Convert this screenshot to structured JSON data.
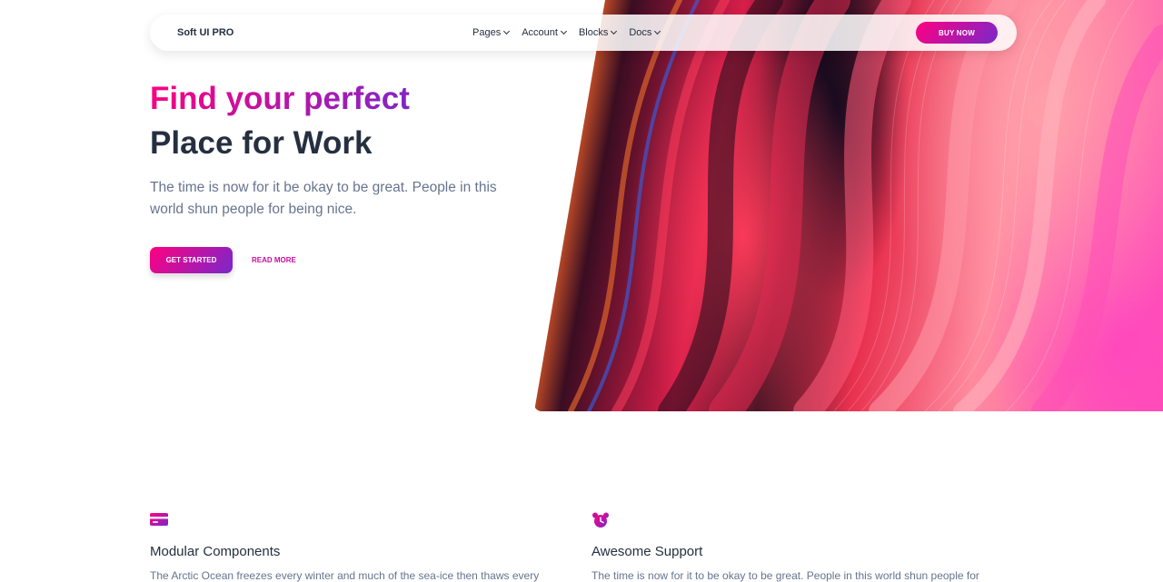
{
  "navbar": {
    "brand": "Soft UI PRO",
    "menu": [
      {
        "label": "Pages"
      },
      {
        "label": "Account"
      },
      {
        "label": "Blocks"
      },
      {
        "label": "Docs"
      }
    ],
    "cta_label": "BUY NOW"
  },
  "hero": {
    "title_line1": "Find your perfect",
    "title_line2": "Place for Work",
    "description": "The time is now for it be okay to be great. People in this world shun people for being nice.",
    "primary_button": "GET STARTED",
    "secondary_link": "READ MORE"
  },
  "features": [
    {
      "icon": "credit-card-icon",
      "title": "Modular Components",
      "text": "The Arctic Ocean freezes every winter and much of the sea-ice then thaws every"
    },
    {
      "icon": "alarm-clock-icon",
      "title": "Awesome Support",
      "text": "The time is now for it to be okay to be great. People in this world shun people for"
    }
  ],
  "colors": {
    "accent_start": "#ff0080",
    "accent_end": "#7928ca",
    "heading": "#252f40",
    "body_text": "#67748e"
  }
}
